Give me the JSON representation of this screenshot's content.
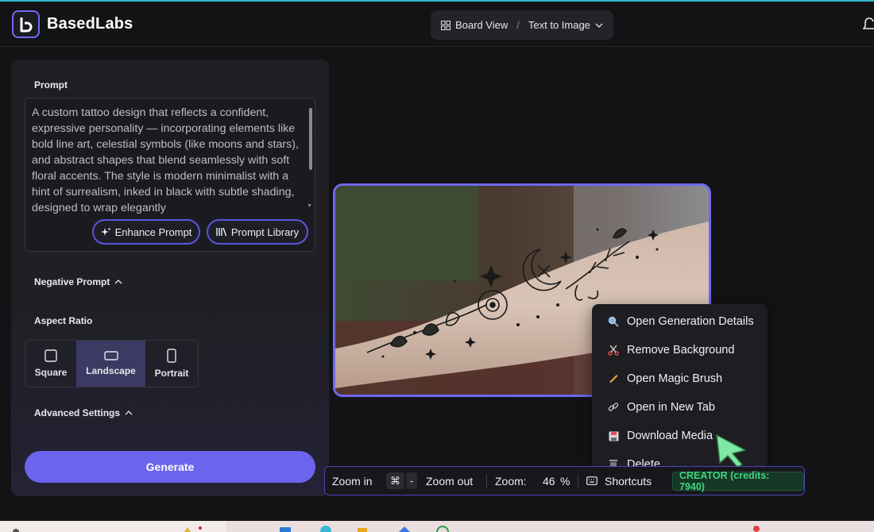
{
  "header": {
    "app_name": "BasedLabs",
    "breadcrumb_view": "Board View",
    "breadcrumb_separator": "/",
    "breadcrumb_mode": "Text to Image"
  },
  "sidebar": {
    "prompt_label": "Prompt",
    "prompt_text": "A custom tattoo design that reflects a confident, expressive personality — incorporating elements like bold line art, celestial symbols (like moons and stars), and abstract shapes that blend seamlessly with soft floral accents. The style is modern minimalist with a hint of surrealism, inked in black with subtle shading, designed to wrap elegantly",
    "enhance_label": "Enhance Prompt",
    "library_label": "Prompt Library",
    "negative_prompt_label": "Negative Prompt",
    "aspect_ratio_label": "Aspect Ratio",
    "aspect_options": [
      {
        "label": "Square",
        "icon": "square-icon",
        "selected": false
      },
      {
        "label": "Landscape",
        "icon": "landscape-icon",
        "selected": true
      },
      {
        "label": "Portrait",
        "icon": "portrait-icon",
        "selected": false
      }
    ],
    "advanced_settings_label": "Advanced Settings",
    "generate_label": "Generate"
  },
  "context_menu": {
    "items": [
      {
        "label": "Open Generation Details",
        "icon": "magnifier-icon"
      },
      {
        "label": "Remove Background",
        "icon": "scissors-icon"
      },
      {
        "label": "Open Magic Brush",
        "icon": "pencil-icon"
      },
      {
        "label": "Open in New Tab",
        "icon": "link-icon"
      },
      {
        "label": "Download Media",
        "icon": "floppy-disk-icon"
      },
      {
        "label": "Delete",
        "icon": "trash-icon"
      }
    ]
  },
  "toolbar": {
    "zoom_in_label": "Zoom in",
    "cmd_key": "⌘",
    "minus_key": "-",
    "zoom_out_label": "Zoom out",
    "zoom_label": "Zoom:",
    "zoom_value": "46",
    "zoom_unit": "%",
    "shortcuts_label": "Shortcuts",
    "credits_label": "CREATOR (credits: 7940)"
  },
  "colors": {
    "accent": "#6b64ee",
    "background": "#131316",
    "panel": "#1f1f23",
    "credits_green": "#3fd77f"
  }
}
